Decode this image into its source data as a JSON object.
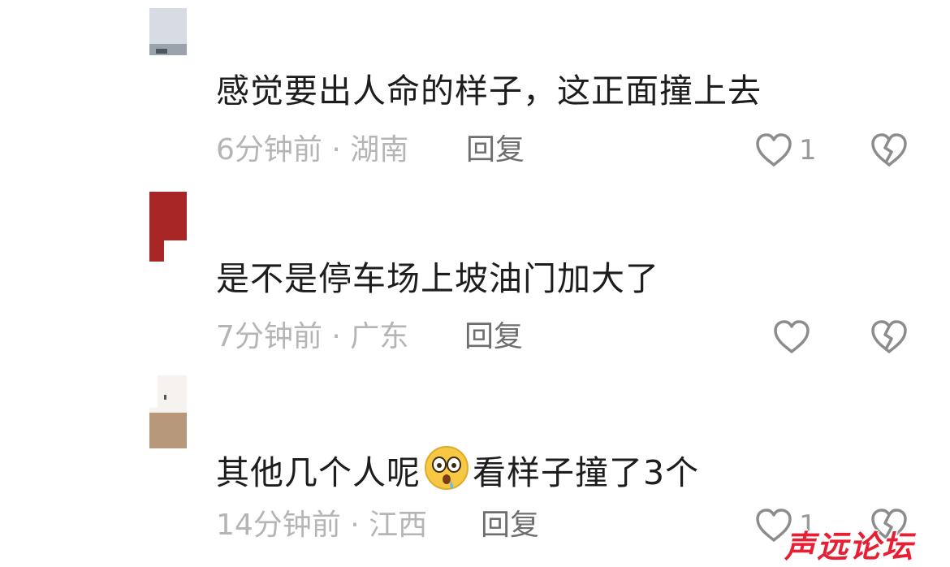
{
  "comments": [
    {
      "text": "感觉要出人命的样子，这正面撞上去",
      "time_location": "6分钟前 · 湖南",
      "reply_label": "回复",
      "like_count": "1",
      "avatar_colors": [
        "#c9d0d8",
        "#8e979e"
      ]
    },
    {
      "text": "是不是停车场上坡油门加大了",
      "time_location": "7分钟前 · 广东",
      "reply_label": "回复",
      "like_count": "",
      "avatar_colors": [
        "#b02a2a",
        "#ffffff"
      ]
    },
    {
      "text_before_emoji": "其他几个人呢",
      "emoji": "shocked-face-emoji",
      "text_after_emoji": "看样子撞了3个",
      "time_location": "14分钟前 · 江西",
      "reply_label": "回复",
      "like_count": "1",
      "avatar_colors": [
        "#f4f1ed",
        "#b99b7e"
      ]
    }
  ],
  "icons": {
    "like": "heart-outline-icon",
    "dislike": "broken-heart-icon"
  },
  "watermark": "声远论坛",
  "colors": {
    "text": "#1d1d1d",
    "meta": "#b5b5b5",
    "reply": "#6e6e6e",
    "icon": "#8c8c8c",
    "watermark": "#e81f33"
  }
}
